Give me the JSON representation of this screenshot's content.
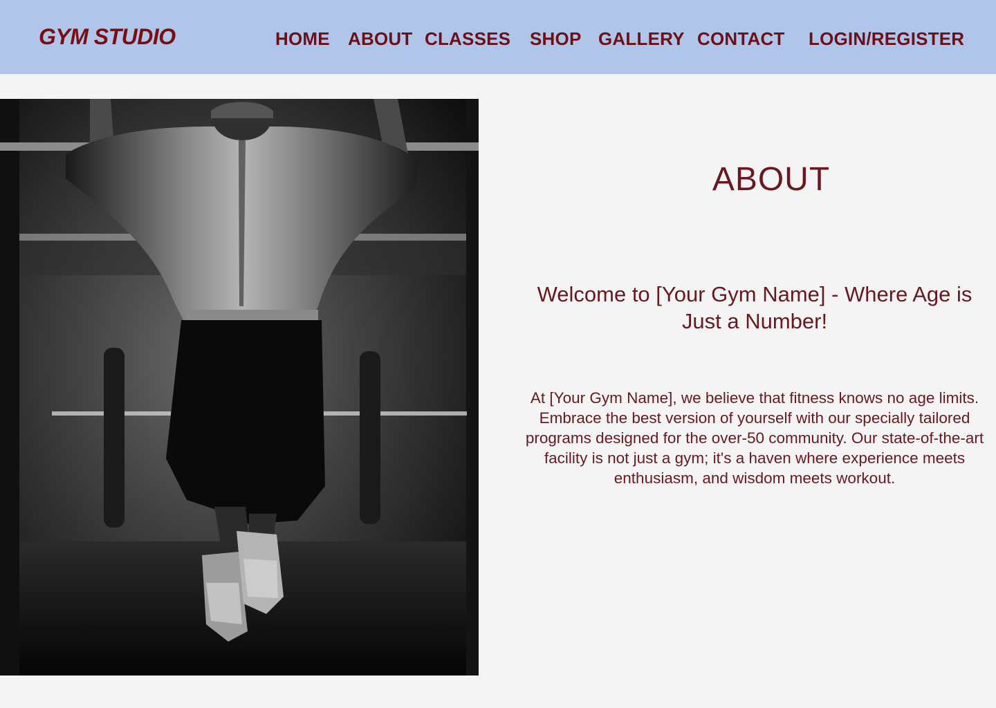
{
  "header": {
    "logo": "GYM STUDIO",
    "nav": [
      "HOME",
      "ABOUT",
      "CLASSES",
      "SHOP",
      "GALLERY",
      "CONTACT",
      "LOGIN/REGISTER"
    ]
  },
  "main": {
    "title": "ABOUT",
    "welcome": "Welcome to [Your Gym Name] - Where Age is Just a Number!",
    "body": "At [Your Gym Name], we believe that fitness knows no age limits. Embrace the best version of yourself with our specially tailored programs designed for the over-50 community. Our state-of-the-art facility is not just a gym; it's a haven where experience meets enthusiasm, and wisdom meets workout."
  },
  "colors": {
    "header_bg": "#afc6ea",
    "accent": "#6e0f17",
    "page_bg": "#f4f4f4"
  }
}
